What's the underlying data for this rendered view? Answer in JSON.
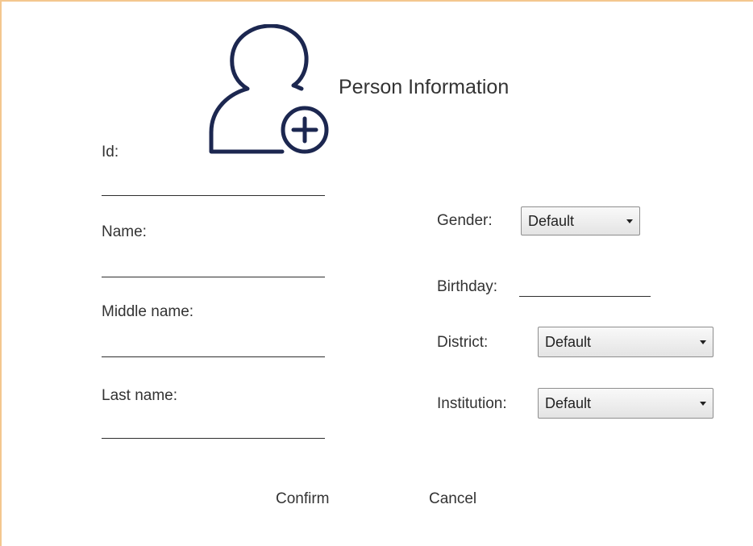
{
  "header": {
    "title": "Person Information",
    "icon": "add-user-icon"
  },
  "colors": {
    "accent_border": "#f4c78f",
    "icon_color": "#1c2750"
  },
  "left_fields": [
    {
      "label": "Id:",
      "value": ""
    },
    {
      "label": "Name:",
      "value": ""
    },
    {
      "label": "Middle name:",
      "value": ""
    },
    {
      "label": "Last name:",
      "value": ""
    }
  ],
  "gender": {
    "label": "Gender:",
    "value": "Default"
  },
  "birthday": {
    "label": "Birthday:",
    "value": ""
  },
  "district": {
    "label": "District:",
    "value": "Default"
  },
  "institution": {
    "label": "Institution:",
    "value": "Default"
  },
  "actions": {
    "confirm": "Confirm",
    "cancel": "Cancel"
  }
}
